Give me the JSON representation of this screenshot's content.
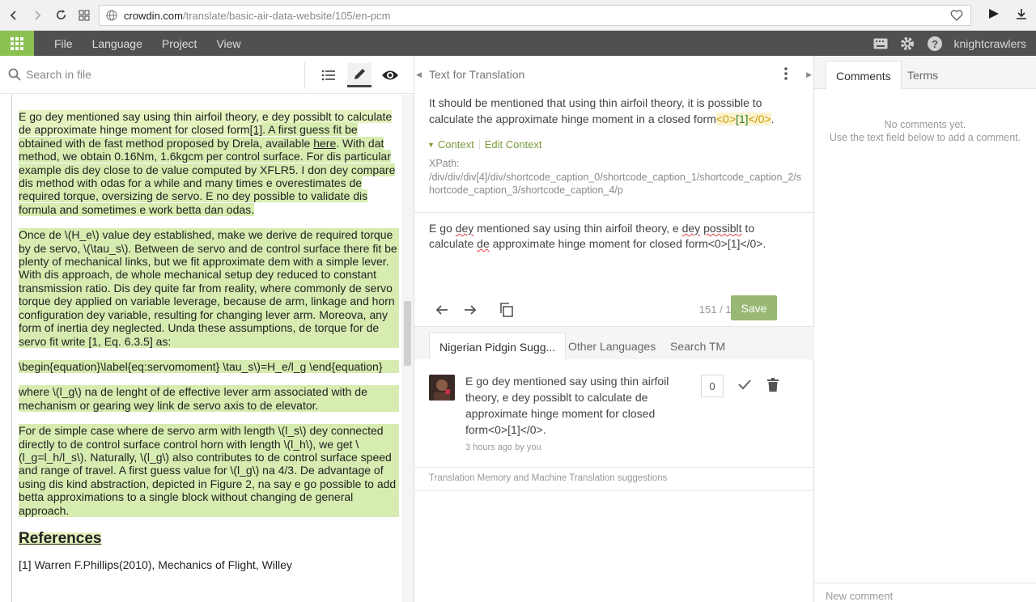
{
  "browser": {
    "url_host": "crowdin.com",
    "url_path": "/translate/basic-air-data-website/105/en-pcm"
  },
  "menu": {
    "items": [
      "File",
      "Language",
      "Project",
      "View"
    ],
    "username": "knightcrawlers"
  },
  "left": {
    "search_placeholder": "Search in file",
    "paragraphs": {
      "p1_a": "E go dey mentioned say using thin airfoil theory, e dey possiblt to calculate de approximate hinge moment for closed form",
      "p1_ref": "[1]",
      "p1_b": ". A first guess fit be obtained with de fast method proposed by Drela, available ",
      "p1_link": "here",
      "p1_c": ". With dat method, we obtain 0.16Nm, 1.6kgcm per control surface. For dis particular example dis dey close to de value computed by XFLR5. I don dey compare dis method with odas for a while and many times e overestimates de required torque, oversizing de servo. E no dey possible to validate dis formula and sometimes e work betta dan odas.",
      "p2": "Once de \\(H_e\\) value dey established, make we derive de required torque by de servo, \\(\\tau_s\\). Between de servo and de control surface there fit be plenty of mechanical links, but we fit approximate dem with a simple lever. With dis approach, de whole mechanical setup dey reduced to constant transmission ratio. Dis dey quite far from reality, where commonly de servo torque dey applied on variable leverage, because de arm, linkage and horn configuration dey variable, resulting for changing lever arm. Moreova, any form of inertia dey neglected. Unda these assumptions, de torque for de servo fit write [1, Eq. 6.3.5] as:",
      "p3": "\\begin{equation}\\label{eq:servomoment} \\tau_s\\)=H_e/l_g \\end{equation}",
      "p4": "where \\(l_g\\) na de lenght of de effective lever arm associated with de mechanism or gearing wey link de servo axis to de elevator.",
      "p5": "For de simple case where de servo arm with length \\(l_s\\) dey connected directly to de control surface control horn with length \\(l_h\\), we get \\(l_g=l_h/l_s\\). Naturally, \\(l_g\\) also contributes to de control surface speed and range of travel. A first guess value for \\(l_g\\) na 4/3. De advantage of using dis kind abstraction, depicted in Figure 2, na say e go possible to add betta approximations to a single block without changing de general approach.",
      "references": "References",
      "ref1": "[1] Warren F.Phillips(2010), Mechanics of Flight, Willey"
    }
  },
  "middle": {
    "title": "Text for Translation",
    "source_text": "It should be mentioned that using thin airfoil theory, it is possible to calculate the approximate hinge moment in a closed form",
    "source_tag1": "<0>",
    "source_tag2": "[1]",
    "source_tag3": "</0>",
    "source_end": ".",
    "context_label": "Context",
    "edit_context_label": "Edit Context",
    "xpath_label": "XPath:",
    "xpath_value": "/div/div/div[4]/div/shortcode_caption_0/shortcode_caption_1/shortcode_caption_2/shortcode_caption_3/shortcode_caption_4/p",
    "translation": {
      "t1": "E go ",
      "t2": "dey",
      "t3": " mentioned say using thin airfoil theory, e ",
      "t4": "dey",
      "t5": " ",
      "t6": "possiblt",
      "t7": " to calculate ",
      "t8": "de",
      "t9": " approximate hinge moment for closed form<0>[1]</0>."
    },
    "counter": "151 / 144",
    "save_label": "Save",
    "tabs": [
      "Nigerian Pidgin Sugg...",
      "Other Languages",
      "Search TM"
    ],
    "suggestion_text": "E go dey mentioned say using thin airfoil theory, e dey possiblt to calculate de approximate hinge moment for closed form<0>[1]</0>.",
    "suggestion_meta": "3 hours ago by you",
    "vote_count": "0",
    "tm_label": "Translation Memory and Machine Translation suggestions"
  },
  "right": {
    "tabs": [
      "Comments",
      "Terms"
    ],
    "no_comments": "No comments yet.",
    "no_comments_hint": "Use the text field below to add a comment.",
    "new_comment_placeholder": "New comment"
  },
  "colors": {
    "accent_green": "#8cc152",
    "save_button": "#98b873",
    "highlight": "#e5f3c0",
    "appbar": "#505050"
  }
}
